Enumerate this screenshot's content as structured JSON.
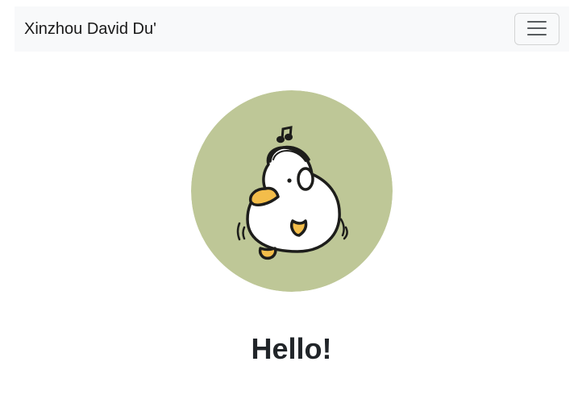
{
  "navbar": {
    "brand": "Xinzhou David Du'",
    "toggler_icon": "hamburger-menu-icon"
  },
  "avatar": {
    "illustration": "duck-with-headphones",
    "background_color": "#bec797"
  },
  "main": {
    "heading": "Hello!"
  }
}
